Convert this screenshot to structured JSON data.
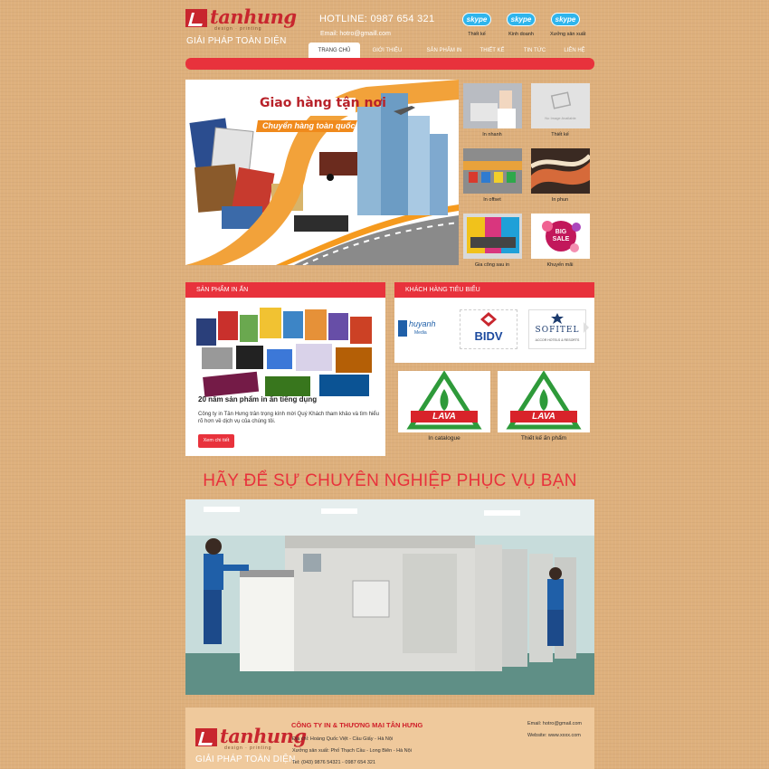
{
  "brand": {
    "name": "tanhung",
    "sub": "design · printing",
    "slogan": "GIẢI PHÁP TOÀN DIỆN"
  },
  "header": {
    "hotline": "HOTLINE: 0987 654 321",
    "email": "Email: hotro@gmaill.com",
    "skype": [
      {
        "badge": "skype",
        "label": "Thiết kế"
      },
      {
        "badge": "skype",
        "label": "Kinh doanh"
      },
      {
        "badge": "skype",
        "label": "Xưởng sản xuất"
      }
    ]
  },
  "nav": {
    "items": [
      {
        "label": "TRANG CHỦ"
      },
      {
        "label": "GIỚI THIỆU"
      },
      {
        "label": "SẢN PHẨM IN"
      },
      {
        "label": "THIẾT KẾ"
      },
      {
        "label": "TIN TỨC"
      },
      {
        "label": "LIÊN HỆ"
      }
    ]
  },
  "banner": {
    "line1": "Giao hàng tận nơi",
    "line2": "Chuyển hàng toàn quốc"
  },
  "thumbs": [
    {
      "label": "In nhanh"
    },
    {
      "label": "Thiết kế",
      "placeholder": "No Image Available"
    },
    {
      "label": "In offset"
    },
    {
      "label": "In phun"
    },
    {
      "label": "Gia công sau in"
    },
    {
      "label": "Khuyến mãi",
      "badge": "BIG SALE"
    }
  ],
  "products": {
    "heading": "SẢN PHẨM IN ẤN",
    "title": "20 năm sản phẩm in ấn tiếng dụng",
    "desc": "Công ty in Tân Hưng trân trọng kính mời Quý Khách tham khảo và tìm hiểu rõ hơn về dịch vụ của chúng tôi.",
    "button": "Xem chi tiết"
  },
  "clients": {
    "heading": "KHÁCH HÀNG TIÊU BIỂU",
    "logos": [
      {
        "name": "huyanh",
        "sub": "Media"
      },
      {
        "name": "BIDV"
      },
      {
        "name": "SOFITEL",
        "sub": "ACCOR HOTELS & RESORTS"
      }
    ]
  },
  "lava": [
    {
      "mark": "LAVA",
      "caption": "In catalogue"
    },
    {
      "mark": "LAVA",
      "caption": "Thiết kế ấn phẩm"
    }
  ],
  "headline": "HÃY ĐỂ SỰ CHUYÊN NGHIỆP PHỤC VỤ BẠN",
  "footer": {
    "company": "CÔNG TY IN & THƯƠNG MẠI TÂN HƯNG",
    "address": "Địa chỉ: Hoàng Quốc Việt - Cầu Giấy - Hà Nội",
    "workshop": "Xưởng sản xuất: Phố Thạch Cầu - Long Biên - Hà Nội",
    "phone": "Tel: (043) 9876 54321 - 0987 654 321",
    "email": "Email: hotro@gmail.com",
    "website": "Website: www.xxxx.com"
  },
  "colors": {
    "accent": "#e8323c",
    "background": "#deb07c",
    "skype": "#2fb5ec"
  }
}
